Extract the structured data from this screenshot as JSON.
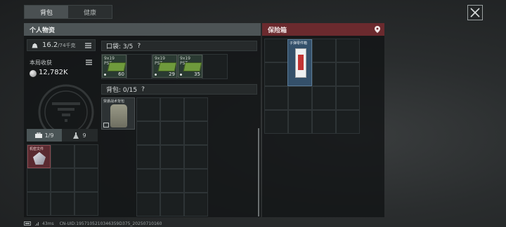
{
  "tabs": [
    "背包",
    "健康"
  ],
  "personal": {
    "title": "个人物资",
    "weight_value": "16.2",
    "weight_unit": "/74千克",
    "earnings_label": "本局收获",
    "earnings_value": "12,782K"
  },
  "pocket": {
    "label": "口袋: 3/5",
    "help": "?"
  },
  "backpack": {
    "label": "背包: 0/15",
    "help": "?",
    "item_label": "突袭战术背包"
  },
  "ammo": [
    {
      "label": "9x19\nPST",
      "count": "60"
    },
    {
      "label": "9x19\nPST",
      "count": "29"
    },
    {
      "label": "9x19\nPST",
      "count": "35"
    }
  ],
  "left_tabs": [
    {
      "label": "1/9",
      "icon": "toolbox-icon"
    },
    {
      "label": "9",
      "icon": "flask-icon"
    }
  ],
  "left_item_label": "机密文件",
  "safebox": {
    "title": "保险箱",
    "item_label": "子弹零件箱"
  },
  "footer": {
    "ping": "43ms",
    "uid": "CN-UID:1957105210346359D375_20250710160"
  },
  "colors": {
    "safebox_header": "#6b2a2e",
    "panel_header": "#4d5456",
    "ammo_green": "#6f9a3c"
  }
}
